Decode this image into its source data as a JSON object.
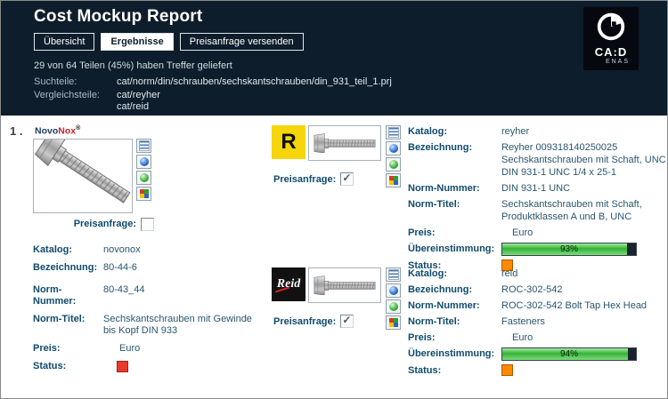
{
  "header": {
    "title": "Cost Mockup Report",
    "tabs": [
      {
        "label": "Übersicht",
        "active": false
      },
      {
        "label": "Ergebnisse",
        "active": true
      },
      {
        "label": "Preisanfrage versenden",
        "active": false
      }
    ],
    "summary": "29 von 64 Teilen (45%) haben Treffer geliefert",
    "search_parts_label": "Suchteile:",
    "search_parts_value": "cat/norm/din/schrauben/sechskantschrauben/din_931_teil_1.prj",
    "compare_parts_label": "Vergleichsteile:",
    "compare_parts_values": [
      "cat/reyher",
      "cat/reid"
    ],
    "logo": {
      "line1": "CA:D",
      "line2": "ENAS"
    }
  },
  "labels": {
    "katalog": "Katalog:",
    "bezeichnung": "Bezeichnung:",
    "norm_nummer": "Norm-Nummer:",
    "norm_titel": "Norm-Titel:",
    "preis": "Preis:",
    "uebereinstimmung": "Übereinstimmung:",
    "status": "Status:",
    "preisanfrage": "Preisanfrage:"
  },
  "icons": {
    "toolbar": [
      "list-icon",
      "sphere-blue-icon",
      "sphere-green-icon",
      "color-grid-icon"
    ]
  },
  "colors": {
    "header_bg": "#0d1d2b",
    "progress_green": "#35b335",
    "status_red": "#e8392b",
    "status_orange": "#ff8a00",
    "reyher_yellow": "#f6d60a",
    "reid_black": "#111111"
  },
  "row": {
    "index": "1 .",
    "source": {
      "brand_prefix": "Novo",
      "brand_suffix": "Nox",
      "brand_mark": "®",
      "preisanfrage": false,
      "katalog": "novonox",
      "bezeichnung": "80-44-6",
      "norm_nummer": "80-43_44",
      "norm_titel": "Sechskantschrauben mit Gewinde bis Kopf  DIN 933",
      "preis": "Euro",
      "status_color": "#e8392b"
    },
    "matches": [
      {
        "logo_text": "R",
        "logo_bg": "#f6d60a",
        "preisanfrage": true,
        "katalog": "reyher",
        "bezeichnung": "Reyher 009318140250025 Sechskantschrauben mit Schaft, UNC DIN 931-1 UNC 1/4 x 25-1",
        "norm_nummer": "DIN 931-1 UNC",
        "norm_titel": "Sechskantschrauben mit Schaft, Produktklassen A und B, UNC",
        "preis": "Euro",
        "match_percent": "93%",
        "status_color": "#ff8a00"
      },
      {
        "logo_text": "Reid",
        "logo_bg": "#111111",
        "preisanfrage": true,
        "katalog": "reid",
        "bezeichnung": "ROC-302-542",
        "norm_nummer": "ROC-302-542 Bolt Tap Hex Head",
        "norm_titel": "Fasteners",
        "preis": "Euro",
        "match_percent": "94%",
        "status_color": "#ff8a00"
      }
    ]
  }
}
